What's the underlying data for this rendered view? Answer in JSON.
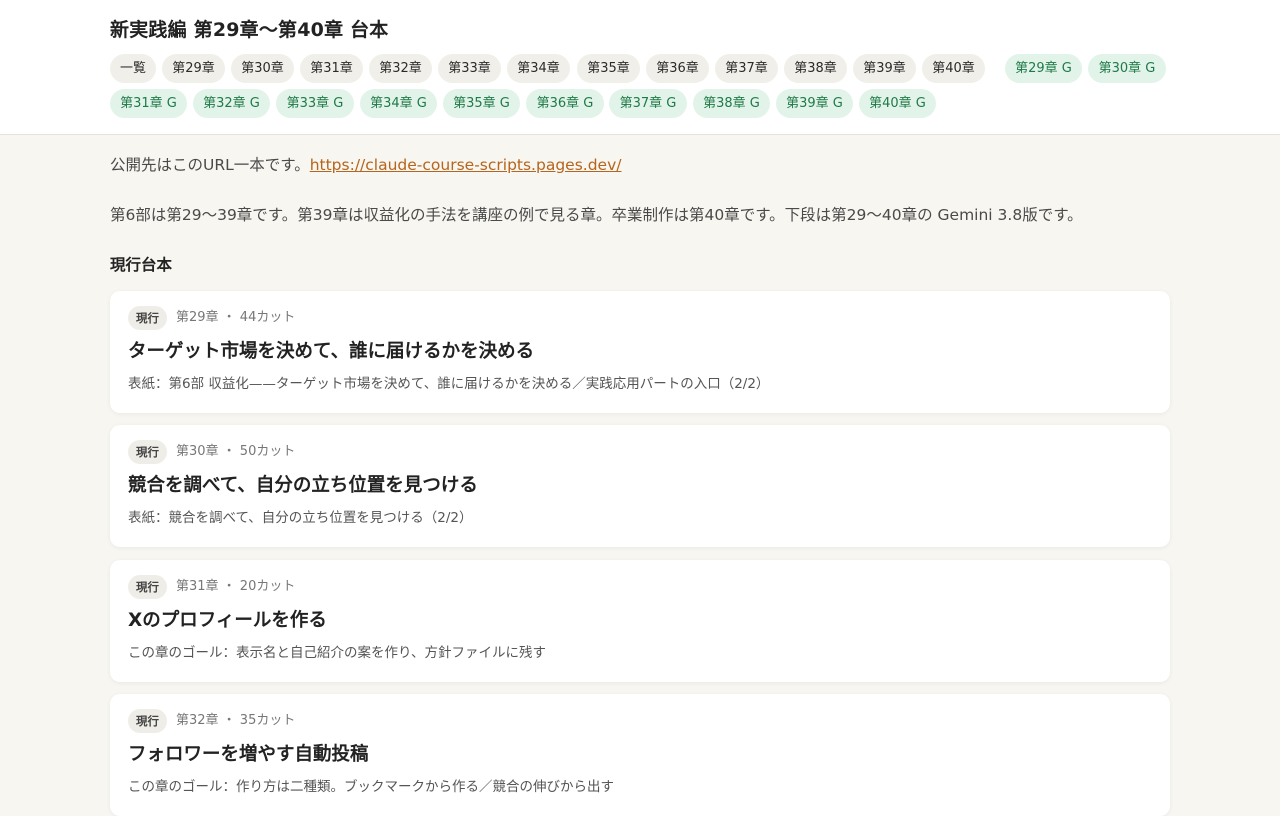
{
  "header": {
    "title": "新実践編 第29章〜第40章 台本",
    "chips_row1": [
      {
        "label": "一覧",
        "kind": "plain"
      },
      {
        "label": "第29章",
        "kind": "plain"
      },
      {
        "label": "第30章",
        "kind": "plain"
      },
      {
        "label": "第31章",
        "kind": "plain"
      },
      {
        "label": "第32章",
        "kind": "plain"
      },
      {
        "label": "第33章",
        "kind": "plain"
      },
      {
        "label": "第34章",
        "kind": "plain"
      },
      {
        "label": "第35章",
        "kind": "plain"
      },
      {
        "label": "第36章",
        "kind": "plain"
      },
      {
        "label": "第37章",
        "kind": "plain"
      },
      {
        "label": "第38章",
        "kind": "plain"
      },
      {
        "label": "第39章",
        "kind": "plain"
      },
      {
        "label": "第40章",
        "kind": "plain"
      },
      {
        "label": "第29章 G",
        "kind": "g"
      },
      {
        "label": "第30章 G",
        "kind": "g"
      }
    ],
    "chips_row2": [
      {
        "label": "第31章 G",
        "kind": "g"
      },
      {
        "label": "第32章 G",
        "kind": "g"
      },
      {
        "label": "第33章 G",
        "kind": "g"
      },
      {
        "label": "第34章 G",
        "kind": "g"
      },
      {
        "label": "第35章 G",
        "kind": "g"
      },
      {
        "label": "第36章 G",
        "kind": "g"
      },
      {
        "label": "第37章 G",
        "kind": "g"
      },
      {
        "label": "第38章 G",
        "kind": "g"
      },
      {
        "label": "第39章 G",
        "kind": "g"
      },
      {
        "label": "第40章 G",
        "kind": "g"
      }
    ]
  },
  "intro": {
    "url_prefix": "公開先はこのURL一本です。",
    "url": "https://claude-course-scripts.pages.dev/",
    "description": "第6部は第29〜39章です。第39章は収益化の手法を講座の例で見る章。卒業制作は第40章です。下段は第29〜40章の Gemini 3.8版です。"
  },
  "section_title": "現行台本",
  "cards": [
    {
      "badge": "現行",
      "meta": "第29章 ・ 44カット",
      "title": "ターゲット市場を決めて、誰に届けるかを決める",
      "desc": "表紙：第6部 収益化——ターゲット市場を決めて、誰に届けるかを決める／実践応用パートの入口（2/2）"
    },
    {
      "badge": "現行",
      "meta": "第30章 ・ 50カット",
      "title": "競合を調べて、自分の立ち位置を見つける",
      "desc": "表紙：競合を調べて、自分の立ち位置を見つける（2/2）"
    },
    {
      "badge": "現行",
      "meta": "第31章 ・ 20カット",
      "title": "Xのプロフィールを作る",
      "desc": "この章のゴール：表示名と自己紹介の案を作り、方針ファイルに残す"
    },
    {
      "badge": "現行",
      "meta": "第32章 ・ 35カット",
      "title": "フォロワーを増やす自動投稿",
      "desc": "この章のゴール：作り方は二種類。ブックマークから作る／競合の伸びから出す"
    }
  ],
  "colors": {
    "page_bg": "#f8f6f0",
    "header_bg": "#ffffff",
    "chip_plain_bg": "#f1efe9",
    "chip_g_bg": "#e2f3ea",
    "chip_g_text": "#1f7a47",
    "link": "#b5651d"
  }
}
